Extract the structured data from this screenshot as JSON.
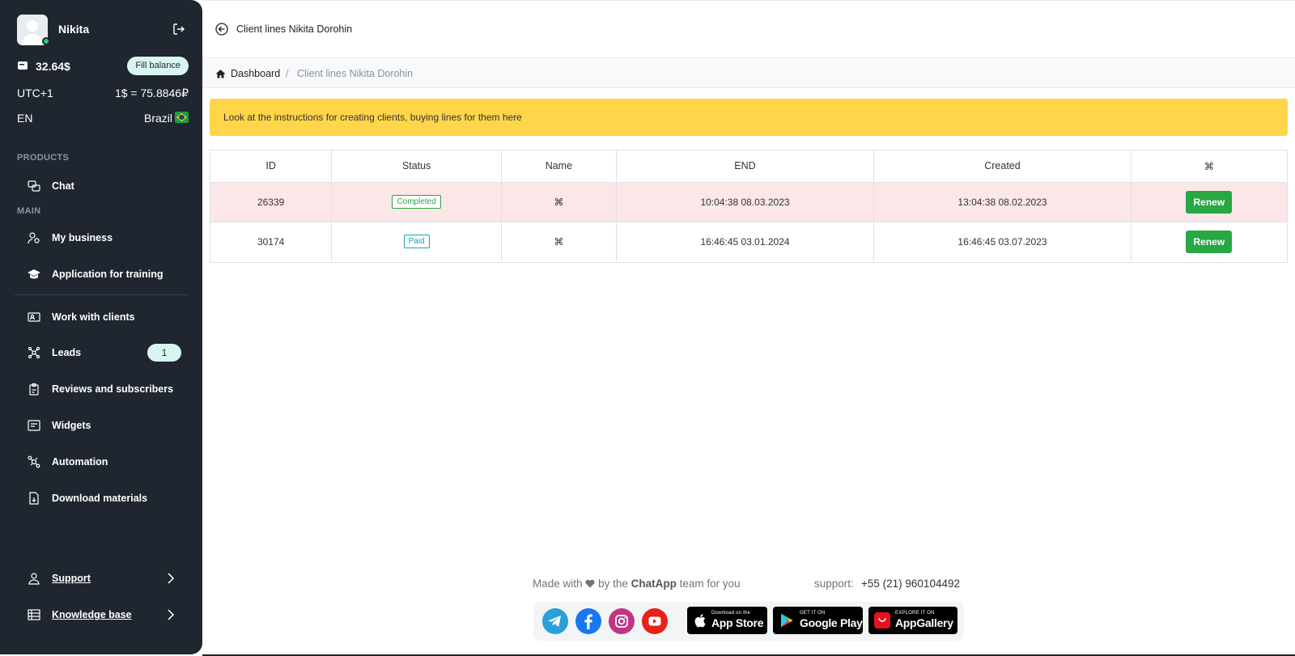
{
  "sidebar": {
    "profile": {
      "name": "Nikita"
    },
    "balance": {
      "value": "32.64$",
      "fill_label": "Fill balance"
    },
    "timezone": "UTC+1",
    "rate": "1$ = 75.8846₽",
    "language": "EN",
    "country": "Brazil",
    "sections": {
      "products": "PRODUCTS",
      "main": "MAIN"
    },
    "items": {
      "chat": "Chat",
      "my_business": "My business",
      "training": "Application for training",
      "work_clients": "Work with clients",
      "leads": "Leads",
      "leads_count": "1",
      "reviews": "Reviews and subscribers",
      "widgets": "Widgets",
      "automation": "Automation",
      "download": "Download materials",
      "support": "Support",
      "knowledge": "Knowledge base"
    }
  },
  "header": {
    "title": "Client lines Nikita Dorohin"
  },
  "breadcrumb": {
    "home": "Dashboard",
    "separator": "/",
    "current": "Client lines Nikita Dorohin"
  },
  "alert": {
    "text": "Look at the instructions for creating clients, buying lines for them here",
    "color": "#ffd54a"
  },
  "table": {
    "columns": [
      "ID",
      "Status",
      "Name",
      "END",
      "Created",
      "⌘"
    ],
    "rows": [
      {
        "id": "26339",
        "status": "Completed",
        "name": "⌘",
        "end": "10:04:38 08.03.2023",
        "created": "13:04:38 08.02.2023",
        "action": "Renew"
      },
      {
        "id": "30174",
        "status": "Paid",
        "name": "⌘",
        "end": "16:46:45 03.01.2024",
        "created": "16:46:45 03.07.2023",
        "action": "Renew"
      }
    ]
  },
  "footer": {
    "made_with": "Made with",
    "by_the": "by the",
    "brand": "ChatApp",
    "team": "team for you",
    "support_label": "support:",
    "support_phone": "+55 (21) 960104492",
    "stores": {
      "appstore_small": "Download on the",
      "appstore_big": "App Store",
      "gplay_small": "GET IT ON",
      "gplay_big": "Google Play",
      "gallery_small": "EXPLORE IT ON",
      "gallery_big": "AppGallery"
    }
  },
  "colors": {
    "sidebar": "#1f2630",
    "success": "#28a745",
    "info": "#17a2b8",
    "row_danger": "#fbe7e8",
    "accent_badge": "#d8f5f0"
  }
}
